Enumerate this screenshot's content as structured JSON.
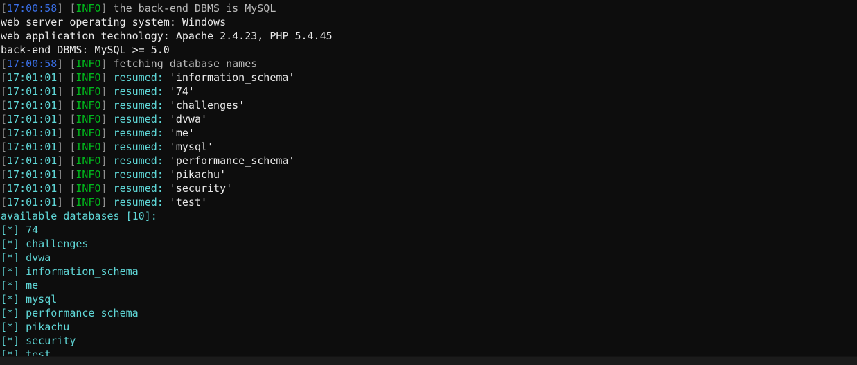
{
  "terminal": {
    "background_color": "#0d0d0d",
    "colors": {
      "timestamp_blue": "#3a6fe6",
      "timestamp_cyan": "#5fd7d7",
      "bracket_gray": "#909090",
      "level_green": "#00b91c",
      "plain_white": "#e9e9e9",
      "value_cyan": "#5fd7d7"
    },
    "lines": [
      {
        "kind": "log",
        "ts_open": "[",
        "timestamp": "17:00:58",
        "ts_close": "]",
        "ts_color": "blue",
        "lvl_open": " [",
        "level": "INFO",
        "lvl_close": "]",
        "message": " the back-end DBMS is MySQL",
        "msg_color": "dim"
      },
      {
        "kind": "plain",
        "text": "web server operating system: Windows"
      },
      {
        "kind": "plain",
        "text": "web application technology: Apache 2.4.23, PHP 5.4.45"
      },
      {
        "kind": "plain",
        "text": "back-end DBMS: MySQL >= 5.0"
      },
      {
        "kind": "log",
        "ts_open": "[",
        "timestamp": "17:00:58",
        "ts_close": "]",
        "ts_color": "blue",
        "lvl_open": " [",
        "level": "INFO",
        "lvl_close": "]",
        "message": " fetching database names",
        "msg_color": "dim"
      },
      {
        "kind": "resumed",
        "ts_open": "[",
        "timestamp": "17:01:01",
        "ts_close": "]",
        "ts_color": "cyan",
        "lvl_open": " [",
        "level": "INFO",
        "lvl_close": "]",
        "label": " resumed: ",
        "value": "'information_schema'"
      },
      {
        "kind": "resumed",
        "ts_open": "[",
        "timestamp": "17:01:01",
        "ts_close": "]",
        "ts_color": "cyan",
        "lvl_open": " [",
        "level": "INFO",
        "lvl_close": "]",
        "label": " resumed: ",
        "value": "'74'"
      },
      {
        "kind": "resumed",
        "ts_open": "[",
        "timestamp": "17:01:01",
        "ts_close": "]",
        "ts_color": "cyan",
        "lvl_open": " [",
        "level": "INFO",
        "lvl_close": "]",
        "label": " resumed: ",
        "value": "'challenges'"
      },
      {
        "kind": "resumed",
        "ts_open": "[",
        "timestamp": "17:01:01",
        "ts_close": "]",
        "ts_color": "cyan",
        "lvl_open": " [",
        "level": "INFO",
        "lvl_close": "]",
        "label": " resumed: ",
        "value": "'dvwa'"
      },
      {
        "kind": "resumed",
        "ts_open": "[",
        "timestamp": "17:01:01",
        "ts_close": "]",
        "ts_color": "cyan",
        "lvl_open": " [",
        "level": "INFO",
        "lvl_close": "]",
        "label": " resumed: ",
        "value": "'me'"
      },
      {
        "kind": "resumed",
        "ts_open": "[",
        "timestamp": "17:01:01",
        "ts_close": "]",
        "ts_color": "cyan",
        "lvl_open": " [",
        "level": "INFO",
        "lvl_close": "]",
        "label": " resumed: ",
        "value": "'mysql'"
      },
      {
        "kind": "resumed",
        "ts_open": "[",
        "timestamp": "17:01:01",
        "ts_close": "]",
        "ts_color": "cyan",
        "lvl_open": " [",
        "level": "INFO",
        "lvl_close": "]",
        "label": " resumed: ",
        "value": "'performance_schema'"
      },
      {
        "kind": "resumed",
        "ts_open": "[",
        "timestamp": "17:01:01",
        "ts_close": "]",
        "ts_color": "cyan",
        "lvl_open": " [",
        "level": "INFO",
        "lvl_close": "]",
        "label": " resumed: ",
        "value": "'pikachu'"
      },
      {
        "kind": "resumed",
        "ts_open": "[",
        "timestamp": "17:01:01",
        "ts_close": "]",
        "ts_color": "cyan",
        "lvl_open": " [",
        "level": "INFO",
        "lvl_close": "]",
        "label": " resumed: ",
        "value": "'security'"
      },
      {
        "kind": "resumed",
        "ts_open": "[",
        "timestamp": "17:01:01",
        "ts_close": "]",
        "ts_color": "cyan",
        "lvl_open": " [",
        "level": "INFO",
        "lvl_close": "]",
        "label": " resumed: ",
        "value": "'test'"
      },
      {
        "kind": "heading",
        "text": "available databases [10]:"
      },
      {
        "kind": "bullet",
        "marker": "[*] ",
        "name": "74"
      },
      {
        "kind": "bullet",
        "marker": "[*] ",
        "name": "challenges"
      },
      {
        "kind": "bullet",
        "marker": "[*] ",
        "name": "dvwa"
      },
      {
        "kind": "bullet",
        "marker": "[*] ",
        "name": "information_schema"
      },
      {
        "kind": "bullet",
        "marker": "[*] ",
        "name": "me"
      },
      {
        "kind": "bullet",
        "marker": "[*] ",
        "name": "mysql"
      },
      {
        "kind": "bullet",
        "marker": "[*] ",
        "name": "performance_schema"
      },
      {
        "kind": "bullet",
        "marker": "[*] ",
        "name": "pikachu"
      },
      {
        "kind": "bullet",
        "marker": "[*] ",
        "name": "security"
      },
      {
        "kind": "bullet",
        "marker": "[*] ",
        "name": "test"
      }
    ]
  }
}
